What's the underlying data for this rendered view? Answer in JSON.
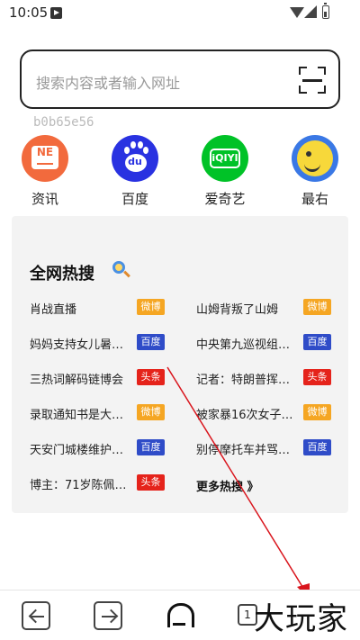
{
  "status_bar": {
    "time": "10:05"
  },
  "search": {
    "placeholder": "搜索内容或者输入网址"
  },
  "device_id": "b0b65e56",
  "shortcuts": [
    {
      "label": "资讯",
      "icon": "news-icon",
      "color": "#f26a3d",
      "glyph": "NE"
    },
    {
      "label": "百度",
      "icon": "baidu-icon",
      "color": "#2932e1",
      "glyph": "du"
    },
    {
      "label": "爱奇艺",
      "icon": "iqiyi-icon",
      "color": "#00c227",
      "glyph": "iQIYI"
    },
    {
      "label": "最右",
      "icon": "zuiyou-icon",
      "color": "#3a78e5"
    }
  ],
  "hot_search": {
    "title": "全网热搜",
    "items": [
      {
        "text": "肖战直播",
        "source": "微博"
      },
      {
        "text": "山姆背叛了山姆",
        "source": "微博"
      },
      {
        "text": "妈妈支持女儿暑…",
        "source": "百度"
      },
      {
        "text": "中央第九巡视组…",
        "source": "百度"
      },
      {
        "text": "三热词解码链博会",
        "source": "头条"
      },
      {
        "text": "记者：特朗普挥…",
        "source": "头条"
      },
      {
        "text": "录取通知书是大…",
        "source": "微博"
      },
      {
        "text": "被家暴16次女子…",
        "source": "微博"
      },
      {
        "text": "天安门城楼维护…",
        "source": "百度"
      },
      {
        "text": "别停摩托车并骂…",
        "source": "百度"
      },
      {
        "text": "博主：71岁陈佩…",
        "source": "头条"
      }
    ],
    "more_label": "更多热搜 》",
    "badge_colors": {
      "微博": "#f5a623",
      "百度": "#2f4cc8",
      "头条": "#e5231b"
    }
  },
  "bottom_bar": {
    "tabs_count": "1",
    "watermark": "大玩家"
  }
}
